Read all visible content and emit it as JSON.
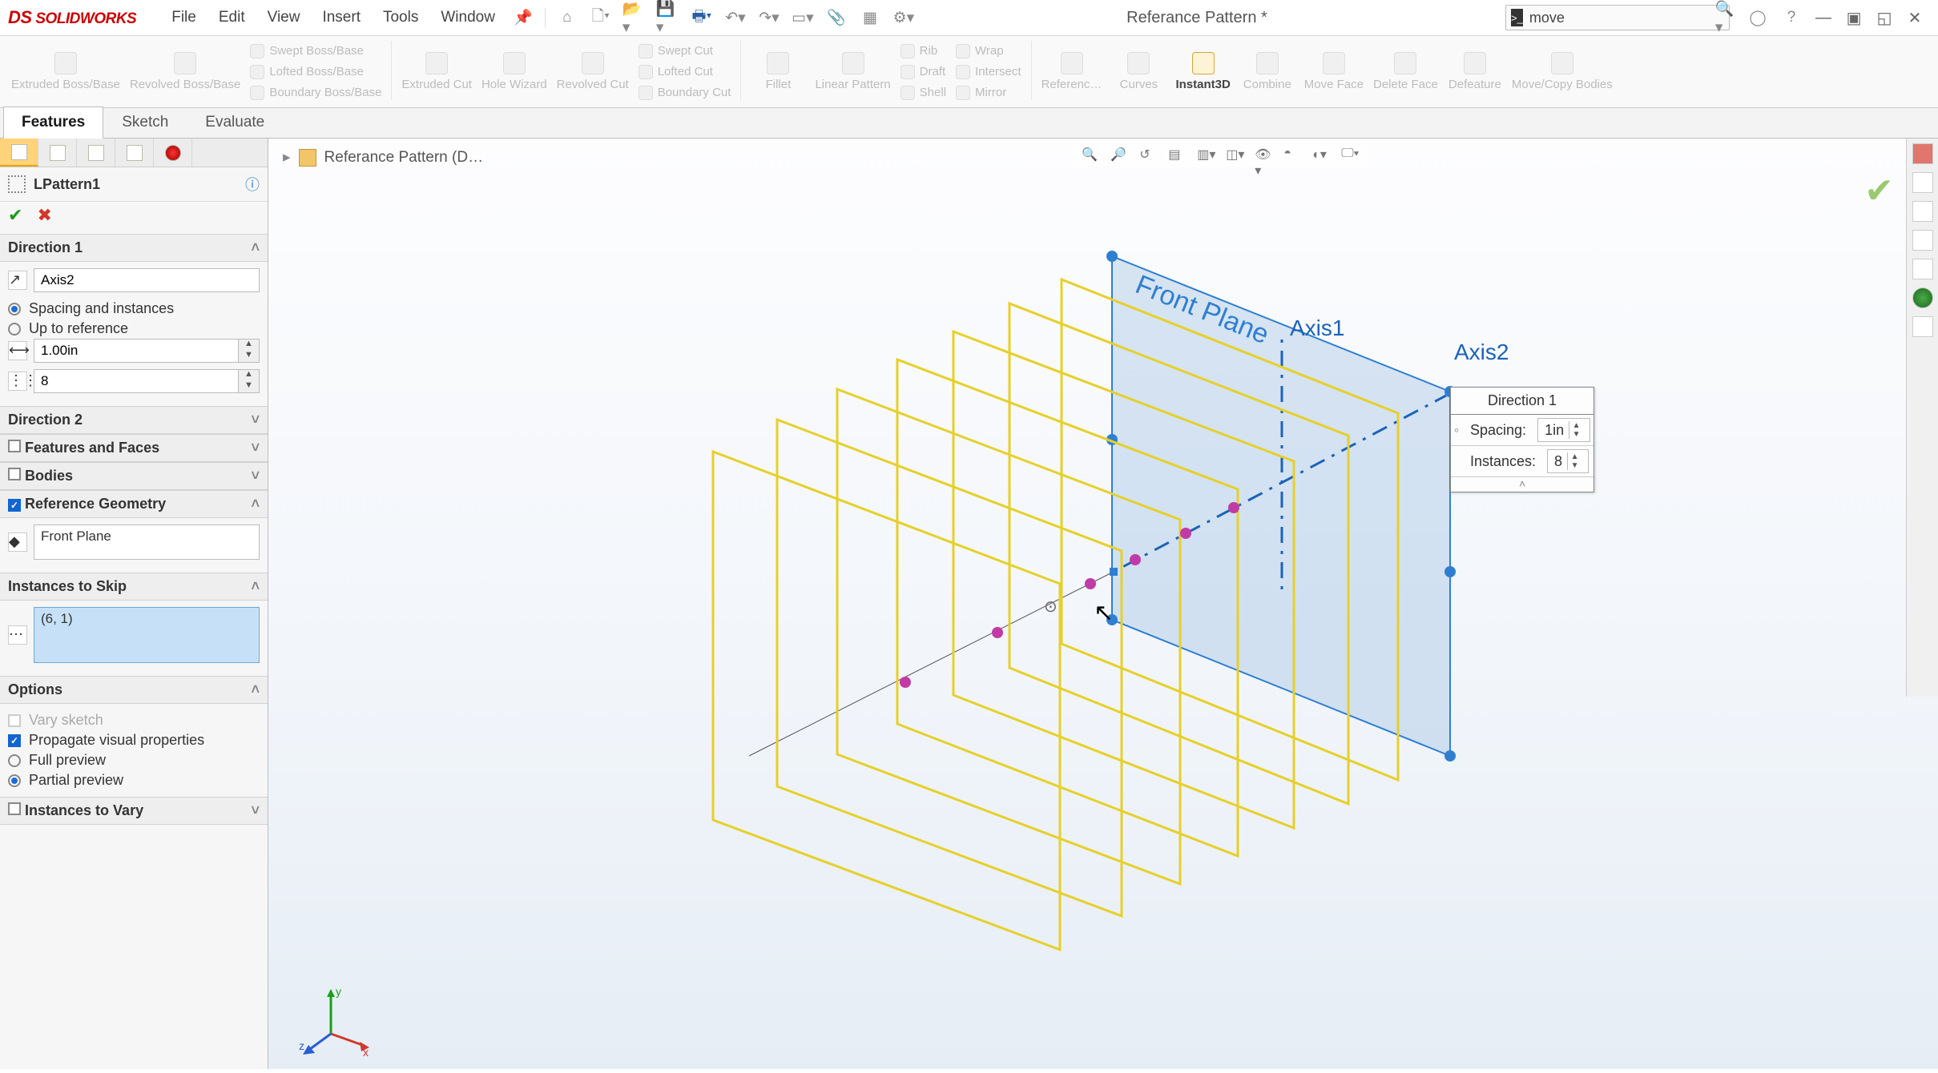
{
  "app": {
    "brand": "SOLIDWORKS",
    "doc_title": "Referance Pattern *"
  },
  "menu": [
    "File",
    "Edit",
    "View",
    "Insert",
    "Tools",
    "Window"
  ],
  "search": {
    "value": "move"
  },
  "ribbon_large": [
    "Extruded Boss/Base",
    "Revolved Boss/Base"
  ],
  "ribbon_boss_small": [
    "Swept Boss/Base",
    "Lofted Boss/Base",
    "Boundary Boss/Base"
  ],
  "ribbon_cut_large": [
    "Extruded Cut",
    "Hole Wizard",
    "Revolved Cut"
  ],
  "ribbon_cut_small": [
    "Swept Cut",
    "Lofted Cut",
    "Boundary Cut"
  ],
  "ribbon_feat_large": [
    "Fillet",
    "Linear Pattern"
  ],
  "ribbon_feat_small": [
    "Rib",
    "Draft",
    "Shell",
    "Wrap",
    "Intersect",
    "Mirror"
  ],
  "ribbon_right": [
    "Referenc…",
    "Curves",
    "Instant3D",
    "Combine",
    "Move Face",
    "Delete Face",
    "Defeature",
    "Move/Copy Bodies"
  ],
  "cmd_tabs": [
    "Features",
    "Sketch",
    "Evaluate"
  ],
  "crumb": "Referance Pattern (D…",
  "pm": {
    "title": "LPattern1",
    "dir1": {
      "head": "Direction 1",
      "axis": "Axis2",
      "opt_spacing": "Spacing and instances",
      "opt_upto": "Up to reference",
      "spacing": "1.00in",
      "count": "8"
    },
    "dir2": "Direction 2",
    "feat_faces": "Features and Faces",
    "bodies": "Bodies",
    "refgeo": {
      "head": "Reference Geometry",
      "value": "Front Plane"
    },
    "skip": {
      "head": "Instances to Skip",
      "value": "(6, 1)"
    },
    "options": {
      "head": "Options",
      "vary_sketch": "Vary sketch",
      "propagate": "Propagate visual properties",
      "full": "Full preview",
      "partial": "Partial preview"
    },
    "inst_vary": "Instances to Vary"
  },
  "scene": {
    "front_plane_label": "Front Plane",
    "axis1": "Axis1",
    "axis2": "Axis2"
  },
  "callout": {
    "title": "Direction 1",
    "spacing_lbl": "Spacing:",
    "spacing_val": "1in",
    "instances_lbl": "Instances:",
    "instances_val": "8"
  },
  "triad": {
    "x": "x",
    "y": "y",
    "z": "z"
  }
}
